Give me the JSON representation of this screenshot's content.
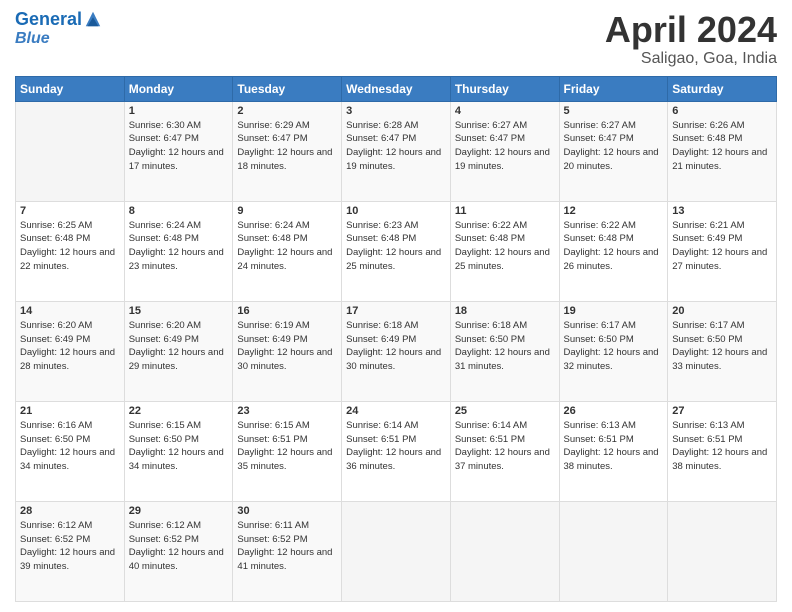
{
  "header": {
    "logo_line1": "General",
    "logo_line2": "Blue",
    "month_title": "April 2024",
    "location": "Saligao, Goa, India"
  },
  "weekdays": [
    "Sunday",
    "Monday",
    "Tuesday",
    "Wednesday",
    "Thursday",
    "Friday",
    "Saturday"
  ],
  "weeks": [
    [
      {
        "day": "",
        "sunrise": "",
        "sunset": "",
        "daylight": ""
      },
      {
        "day": "1",
        "sunrise": "6:30 AM",
        "sunset": "6:47 PM",
        "daylight": "12 hours and 17 minutes."
      },
      {
        "day": "2",
        "sunrise": "6:29 AM",
        "sunset": "6:47 PM",
        "daylight": "12 hours and 18 minutes."
      },
      {
        "day": "3",
        "sunrise": "6:28 AM",
        "sunset": "6:47 PM",
        "daylight": "12 hours and 19 minutes."
      },
      {
        "day": "4",
        "sunrise": "6:27 AM",
        "sunset": "6:47 PM",
        "daylight": "12 hours and 19 minutes."
      },
      {
        "day": "5",
        "sunrise": "6:27 AM",
        "sunset": "6:47 PM",
        "daylight": "12 hours and 20 minutes."
      },
      {
        "day": "6",
        "sunrise": "6:26 AM",
        "sunset": "6:48 PM",
        "daylight": "12 hours and 21 minutes."
      }
    ],
    [
      {
        "day": "7",
        "sunrise": "6:25 AM",
        "sunset": "6:48 PM",
        "daylight": "12 hours and 22 minutes."
      },
      {
        "day": "8",
        "sunrise": "6:24 AM",
        "sunset": "6:48 PM",
        "daylight": "12 hours and 23 minutes."
      },
      {
        "day": "9",
        "sunrise": "6:24 AM",
        "sunset": "6:48 PM",
        "daylight": "12 hours and 24 minutes."
      },
      {
        "day": "10",
        "sunrise": "6:23 AM",
        "sunset": "6:48 PM",
        "daylight": "12 hours and 25 minutes."
      },
      {
        "day": "11",
        "sunrise": "6:22 AM",
        "sunset": "6:48 PM",
        "daylight": "12 hours and 25 minutes."
      },
      {
        "day": "12",
        "sunrise": "6:22 AM",
        "sunset": "6:48 PM",
        "daylight": "12 hours and 26 minutes."
      },
      {
        "day": "13",
        "sunrise": "6:21 AM",
        "sunset": "6:49 PM",
        "daylight": "12 hours and 27 minutes."
      }
    ],
    [
      {
        "day": "14",
        "sunrise": "6:20 AM",
        "sunset": "6:49 PM",
        "daylight": "12 hours and 28 minutes."
      },
      {
        "day": "15",
        "sunrise": "6:20 AM",
        "sunset": "6:49 PM",
        "daylight": "12 hours and 29 minutes."
      },
      {
        "day": "16",
        "sunrise": "6:19 AM",
        "sunset": "6:49 PM",
        "daylight": "12 hours and 30 minutes."
      },
      {
        "day": "17",
        "sunrise": "6:18 AM",
        "sunset": "6:49 PM",
        "daylight": "12 hours and 30 minutes."
      },
      {
        "day": "18",
        "sunrise": "6:18 AM",
        "sunset": "6:50 PM",
        "daylight": "12 hours and 31 minutes."
      },
      {
        "day": "19",
        "sunrise": "6:17 AM",
        "sunset": "6:50 PM",
        "daylight": "12 hours and 32 minutes."
      },
      {
        "day": "20",
        "sunrise": "6:17 AM",
        "sunset": "6:50 PM",
        "daylight": "12 hours and 33 minutes."
      }
    ],
    [
      {
        "day": "21",
        "sunrise": "6:16 AM",
        "sunset": "6:50 PM",
        "daylight": "12 hours and 34 minutes."
      },
      {
        "day": "22",
        "sunrise": "6:15 AM",
        "sunset": "6:50 PM",
        "daylight": "12 hours and 34 minutes."
      },
      {
        "day": "23",
        "sunrise": "6:15 AM",
        "sunset": "6:51 PM",
        "daylight": "12 hours and 35 minutes."
      },
      {
        "day": "24",
        "sunrise": "6:14 AM",
        "sunset": "6:51 PM",
        "daylight": "12 hours and 36 minutes."
      },
      {
        "day": "25",
        "sunrise": "6:14 AM",
        "sunset": "6:51 PM",
        "daylight": "12 hours and 37 minutes."
      },
      {
        "day": "26",
        "sunrise": "6:13 AM",
        "sunset": "6:51 PM",
        "daylight": "12 hours and 38 minutes."
      },
      {
        "day": "27",
        "sunrise": "6:13 AM",
        "sunset": "6:51 PM",
        "daylight": "12 hours and 38 minutes."
      }
    ],
    [
      {
        "day": "28",
        "sunrise": "6:12 AM",
        "sunset": "6:52 PM",
        "daylight": "12 hours and 39 minutes."
      },
      {
        "day": "29",
        "sunrise": "6:12 AM",
        "sunset": "6:52 PM",
        "daylight": "12 hours and 40 minutes."
      },
      {
        "day": "30",
        "sunrise": "6:11 AM",
        "sunset": "6:52 PM",
        "daylight": "12 hours and 41 minutes."
      },
      {
        "day": "",
        "sunrise": "",
        "sunset": "",
        "daylight": ""
      },
      {
        "day": "",
        "sunrise": "",
        "sunset": "",
        "daylight": ""
      },
      {
        "day": "",
        "sunrise": "",
        "sunset": "",
        "daylight": ""
      },
      {
        "day": "",
        "sunrise": "",
        "sunset": "",
        "daylight": ""
      }
    ]
  ],
  "labels": {
    "sunrise_prefix": "Sunrise: ",
    "sunset_prefix": "Sunset: ",
    "daylight_prefix": "Daylight: "
  }
}
